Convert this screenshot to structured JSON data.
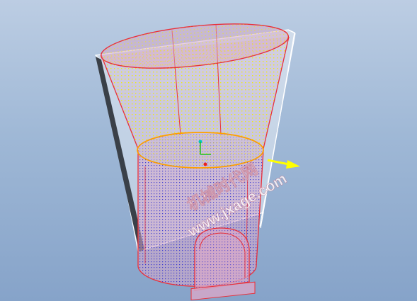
{
  "viewport": {
    "background_top": "#bccde3",
    "background_bottom": "#86a3c9"
  },
  "model": {
    "surface_edge_color": "#e8303a",
    "mesh_color_upper": "#f2f000",
    "mesh_color_lower": "#2a2ad0",
    "fill_color": "#d8a8c8",
    "highlight_edge_color": "#ffa000",
    "datum_plane_color": "#ffffff"
  },
  "direction_arrow": {
    "color": "#ffff00",
    "icon": "arrow-right-icon"
  },
  "watermark": {
    "line1": "机械时代网",
    "line2": "www.jxage.com"
  }
}
